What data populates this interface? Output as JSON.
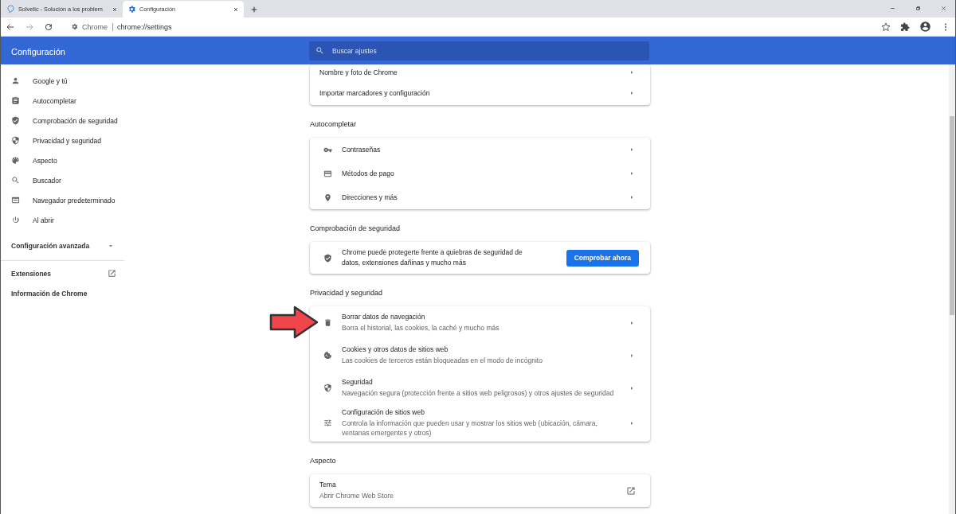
{
  "browser": {
    "tabs": [
      {
        "title": "Solvetic - Solución a los problem",
        "selected": false
      },
      {
        "title": "Configuración",
        "selected": true
      }
    ],
    "site_label": "Chrome",
    "url": "chrome://settings"
  },
  "header": {
    "title": "Configuración",
    "search": {
      "placeholder": "Buscar ajustes"
    }
  },
  "sidebar": {
    "items": [
      "Google y tú",
      "Autocompletar",
      "Comprobación de seguridad",
      "Privacidad y seguridad",
      "Aspecto",
      "Buscador",
      "Navegador predeterminado",
      "Al abrir"
    ],
    "advanced": {
      "label": "Configuración avanzada",
      "expanded": false
    },
    "links": [
      {
        "label": "Extensiones",
        "external": true
      },
      {
        "label": "Información de Chrome",
        "external": false
      }
    ]
  },
  "sections": [
    {
      "rows": [
        {
          "kind": "link",
          "title": "Nombre y foto de Chrome"
        },
        {
          "kind": "link",
          "title": "Importar marcadores y configuración"
        }
      ]
    },
    {
      "heading": "Autocompletar",
      "rows": [
        {
          "kind": "link",
          "title": "Contraseñas"
        },
        {
          "kind": "link",
          "title": "Métodos de pago"
        },
        {
          "kind": "link",
          "title": "Direcciones y más"
        }
      ]
    },
    {
      "heading": "Comprobación de seguridad",
      "rows": [
        {
          "kind": "action",
          "title": "Chrome puede protegerte frente a quiebras de seguridad de datos, extensiones dañinas y mucho más",
          "button": "Comprobar ahora"
        }
      ]
    },
    {
      "heading": "Privacidad y seguridad",
      "rows": [
        {
          "kind": "link",
          "title": "Borrar datos de navegación",
          "subtitle": "Borra el historial, las cookies, la caché y mucho más"
        },
        {
          "kind": "link",
          "title": "Cookies y otros datos de sitios web",
          "subtitle": "Las cookies de terceros están bloqueadas en el modo de incógnito"
        },
        {
          "kind": "link",
          "title": "Seguridad",
          "subtitle": "Navegación segura (protección frente a sitios web peligrosos) y otros ajustes de seguridad"
        },
        {
          "kind": "link",
          "title": "Configuración de sitios web",
          "subtitle": "Controla la información que pueden usar y mostrar los sitios web (ubicación, cámara, ventanas emergentes y otros)"
        }
      ]
    },
    {
      "heading": "Aspecto",
      "rows": [
        {
          "kind": "external",
          "title": "Tema",
          "subtitle": "Abrir Chrome Web Store"
        }
      ]
    }
  ]
}
